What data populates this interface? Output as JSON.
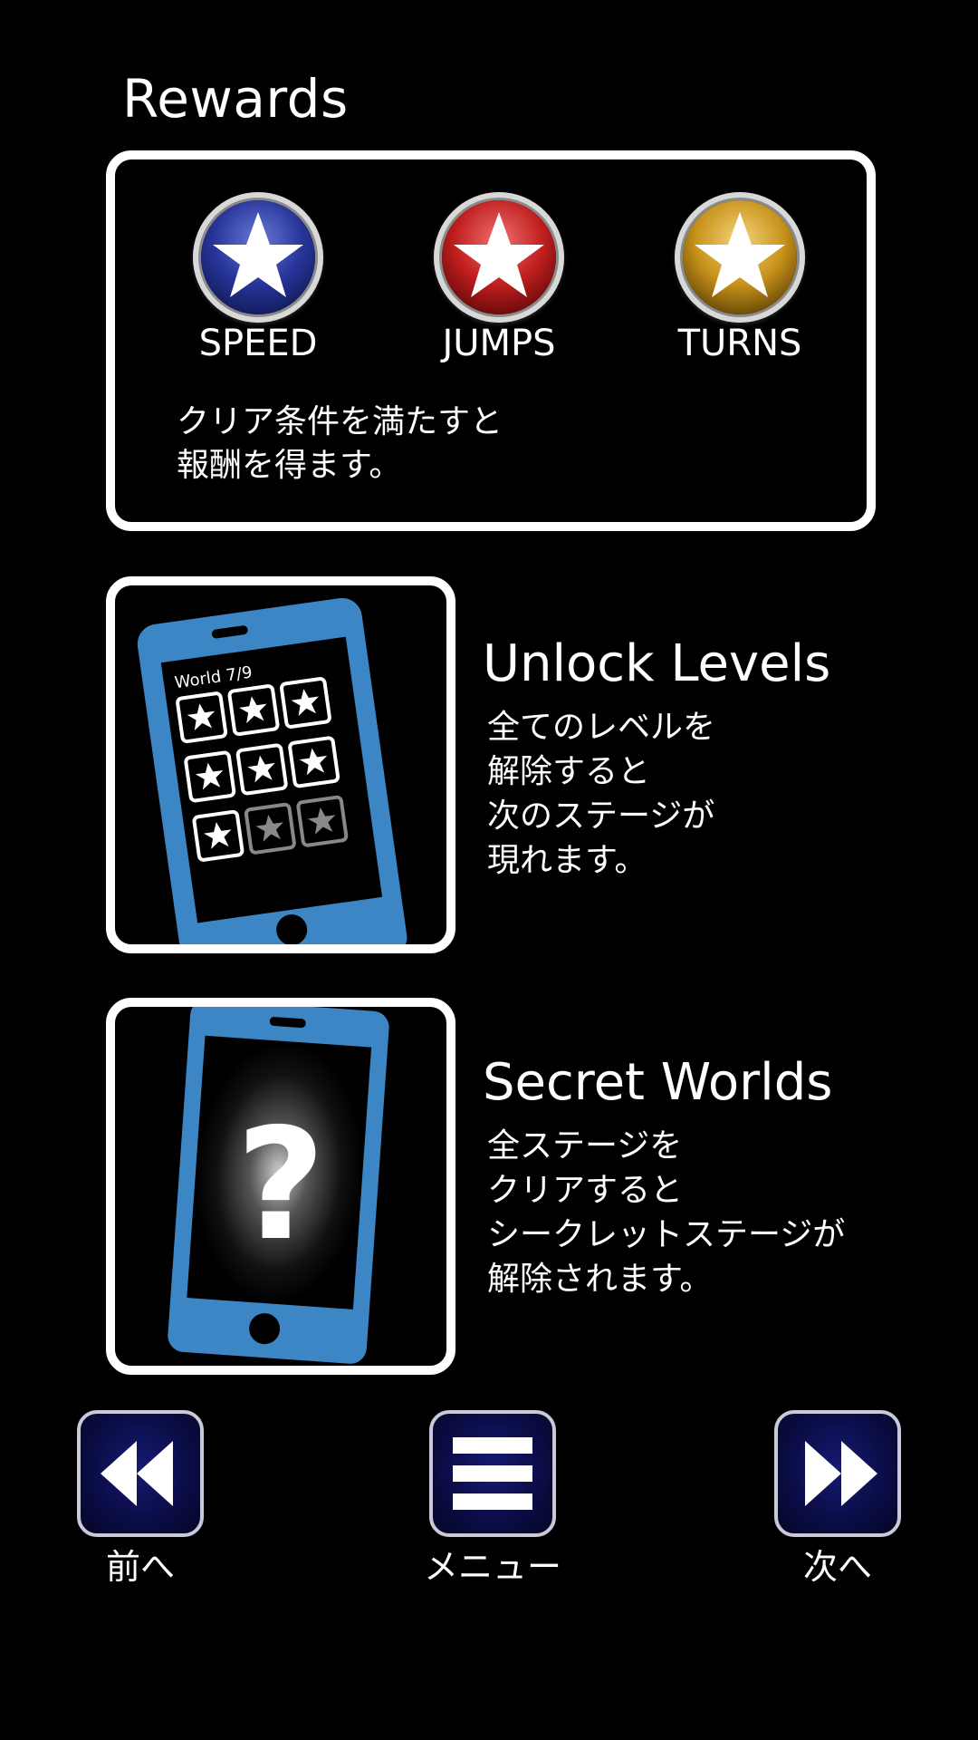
{
  "rewards": {
    "title": "Rewards",
    "medals": [
      {
        "label": "SPEED",
        "icon": "blue-star-medal-icon",
        "color": "#2a3aa0"
      },
      {
        "label": "JUMPS",
        "icon": "red-star-medal-icon",
        "color": "#c0201e"
      },
      {
        "label": "TURNS",
        "icon": "gold-star-medal-icon",
        "color": "#c9961a"
      }
    ],
    "description_line1": "クリア条件を満たすと",
    "description_line2": "報酬を得ます。"
  },
  "unlock": {
    "title": "Unlock Levels",
    "phone_world_label": "World 7/9",
    "lines": [
      "全てのレベルを",
      "解除すると",
      "次のステージが",
      "現れます。"
    ]
  },
  "secret": {
    "title": "Secret Worlds",
    "phone_symbol": "?",
    "lines": [
      "全ステージを",
      "クリアすると",
      "シークレットステージが",
      "解除されます。"
    ]
  },
  "nav": {
    "prev_label": "前へ",
    "menu_label": "メニュー",
    "next_label": "次へ"
  },
  "colors": {
    "phone_blue": "#3d86c6",
    "button_navy": "#0b0d48"
  }
}
